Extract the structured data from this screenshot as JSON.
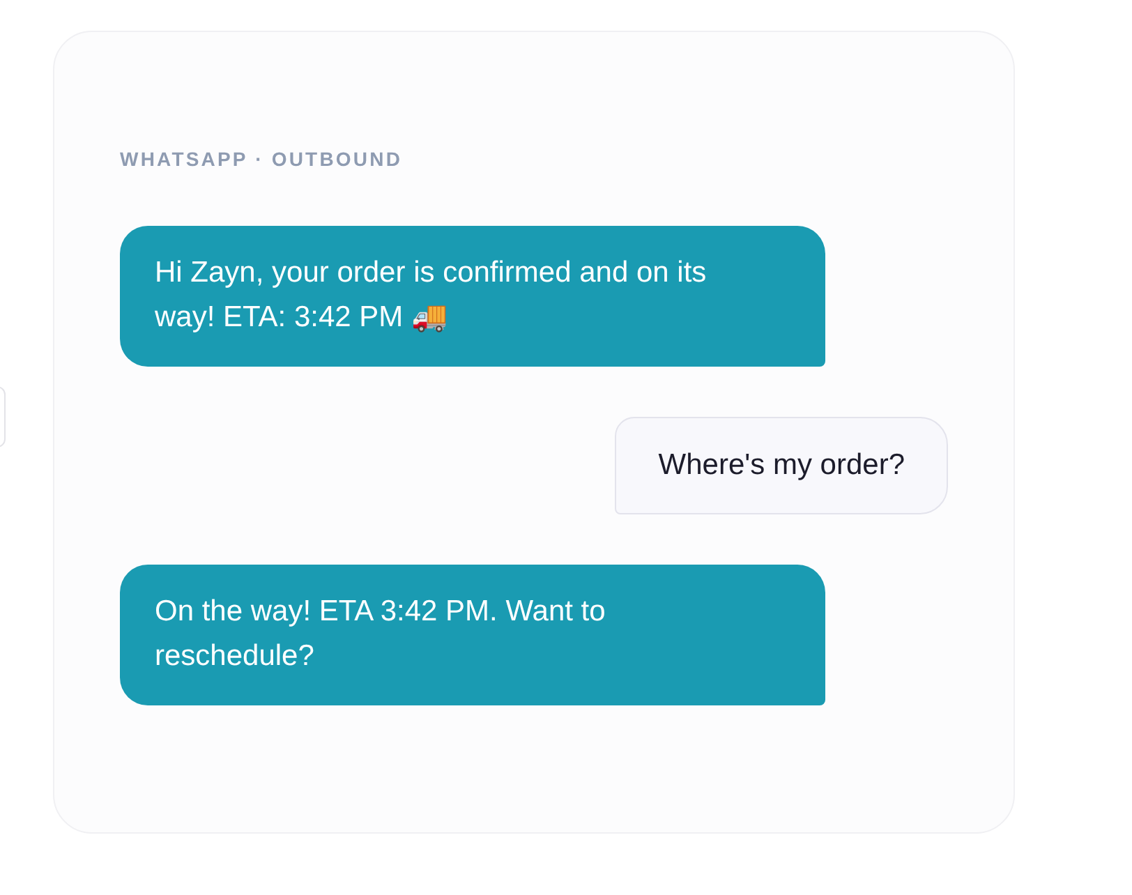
{
  "channel_label": "WHATSAPP · OUTBOUND",
  "messages": [
    {
      "kind": "outgoing",
      "text": "Hi Zayn, your order is confirmed and on its way! ETA: 3:42 PM 🚚"
    },
    {
      "kind": "incoming",
      "text": "Where's my order?"
    },
    {
      "kind": "outgoing",
      "text": "On the way! ETA 3:42 PM. Want to reschedule?"
    }
  ]
}
